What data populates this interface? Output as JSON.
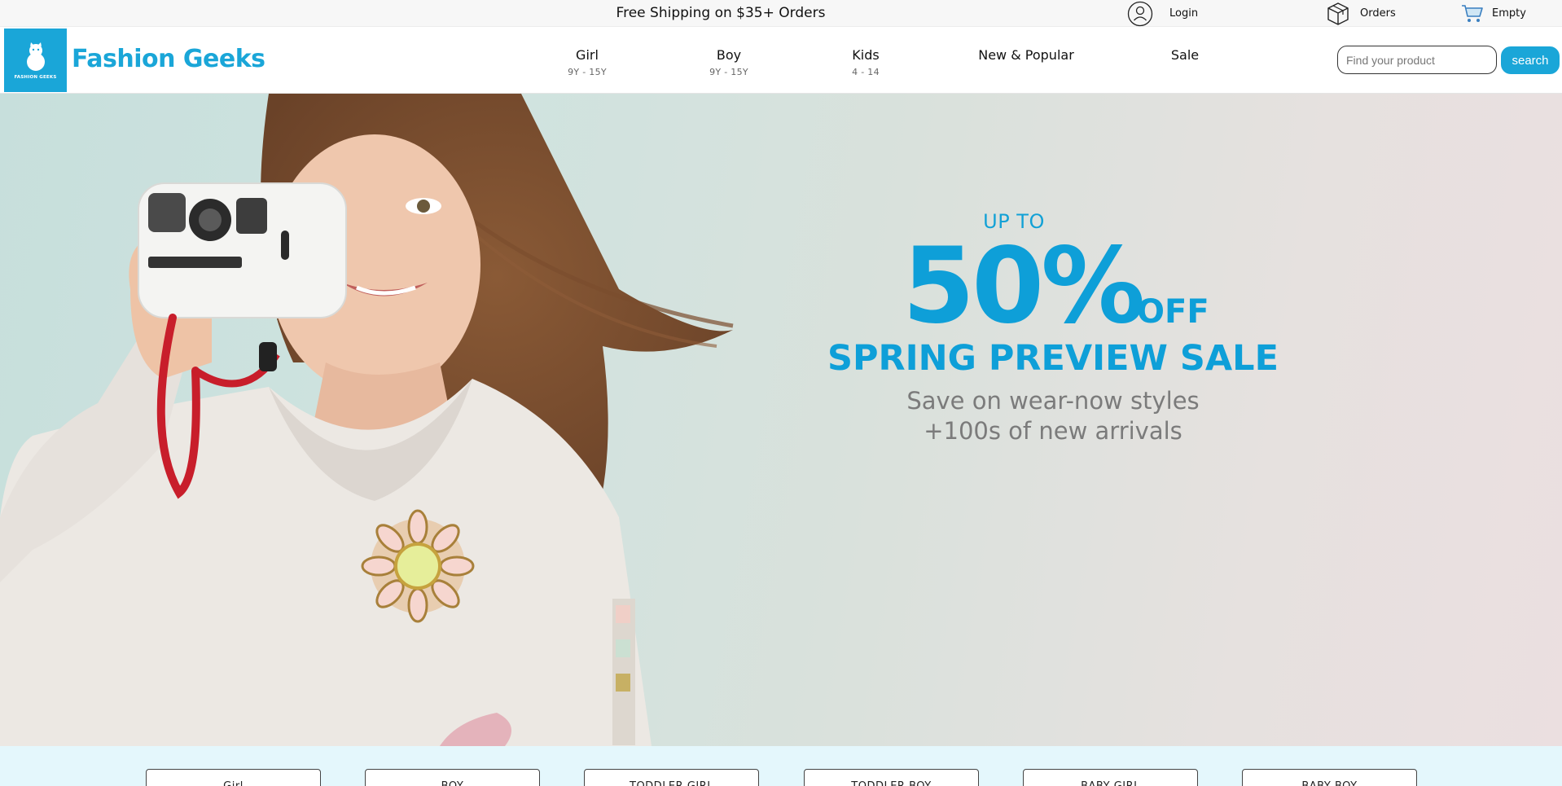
{
  "topbar": {
    "promo": "Free Shipping on $35+ Orders",
    "login_label": "Login",
    "orders_label": "Orders",
    "cart_label": "Empty"
  },
  "header": {
    "brand": "Fashion Geeks",
    "logo_text": "FASHION GEEKS",
    "nav": [
      {
        "label": "Girl",
        "sub": "9Y - 15Y"
      },
      {
        "label": "Boy",
        "sub": "9Y - 15Y"
      },
      {
        "label": "Kids",
        "sub": "4 - 14"
      },
      {
        "label": "New & Popular",
        "sub": ""
      },
      {
        "label": "Sale",
        "sub": ""
      }
    ],
    "search": {
      "placeholder": "Find your product",
      "button_label": "search"
    }
  },
  "hero": {
    "up_to": "UP TO",
    "discount": "50%",
    "off": "OFF",
    "headline": "SPRING PREVIEW SALE",
    "line1": "Save on wear-now styles",
    "line2": "+100s of new arrivals"
  },
  "categories": [
    "Girl",
    "BOY",
    "TODDLER GIRL",
    "TODDLER BOY",
    "BABY GIRL",
    "BABY BOY"
  ],
  "colors": {
    "accent": "#1aa6d8",
    "hero_text": "#0e9fd8",
    "strip_bg": "#e4f7fc"
  },
  "icons": {
    "login": "user-circle-icon",
    "orders": "box-icon",
    "cart": "cart-icon"
  }
}
